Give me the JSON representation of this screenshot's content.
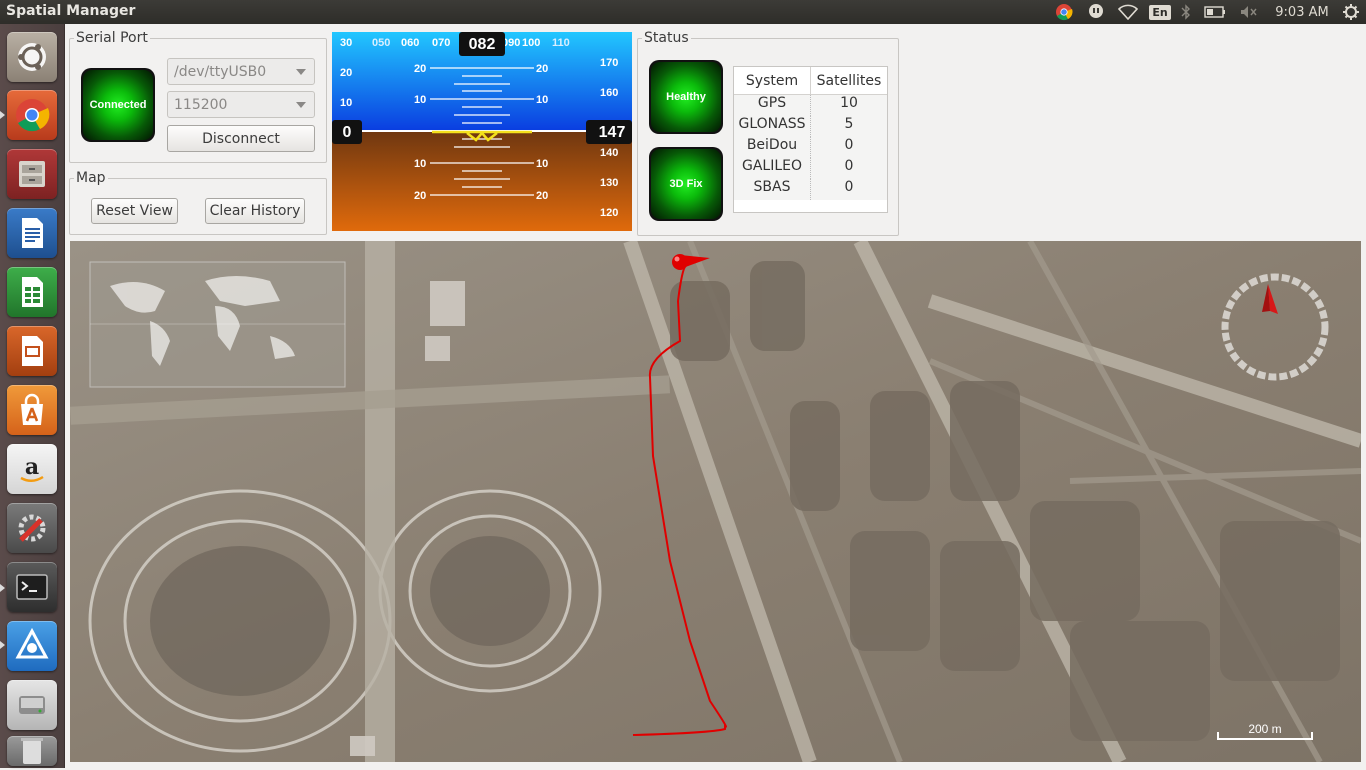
{
  "window": {
    "title": "Spatial Manager"
  },
  "tray": {
    "lang": "En",
    "clock": "9:03 AM"
  },
  "launcher": {
    "items": [
      "ubuntu-dash",
      "chrome",
      "file-manager",
      "writer",
      "calc",
      "impress",
      "software-center",
      "amazon",
      "system-settings",
      "terminal",
      "remote-app",
      "disk-drive",
      "trash"
    ]
  },
  "serial_port": {
    "title": "Serial Port",
    "status": "Connected",
    "device": "/dev/ttyUSB0",
    "baud": "115200",
    "disconnect_label": "Disconnect"
  },
  "map_group": {
    "title": "Map",
    "reset_label": "Reset View",
    "clear_label": "Clear History"
  },
  "horizon": {
    "heading": "082",
    "altitude": "147",
    "speed": "0",
    "heading_ticks": [
      "30",
      "050",
      "060",
      "070",
      "090",
      "100",
      "110"
    ],
    "left_ticks": [
      "20",
      "10"
    ],
    "right_ticks": [
      "170",
      "160",
      "140",
      "130",
      "120"
    ],
    "pitch_labels": [
      "20",
      "10",
      "10",
      "20"
    ],
    "sky_color": "#1e86f0",
    "ground_color": "#b5561b"
  },
  "status": {
    "title": "Status",
    "health": "Healthy",
    "fix": "3D Fix",
    "columns": [
      "System",
      "Satellites"
    ],
    "rows": [
      {
        "system": "GPS",
        "satellites": "10"
      },
      {
        "system": "GLONASS",
        "satellites": "5"
      },
      {
        "system": "BeiDou",
        "satellites": "0"
      },
      {
        "system": "GALILEO",
        "satellites": "0"
      },
      {
        "system": "SBAS",
        "satellites": "0"
      }
    ]
  },
  "map": {
    "scale_label": "200 m",
    "track_color": "#e00000",
    "marker_color": "#e00000"
  }
}
